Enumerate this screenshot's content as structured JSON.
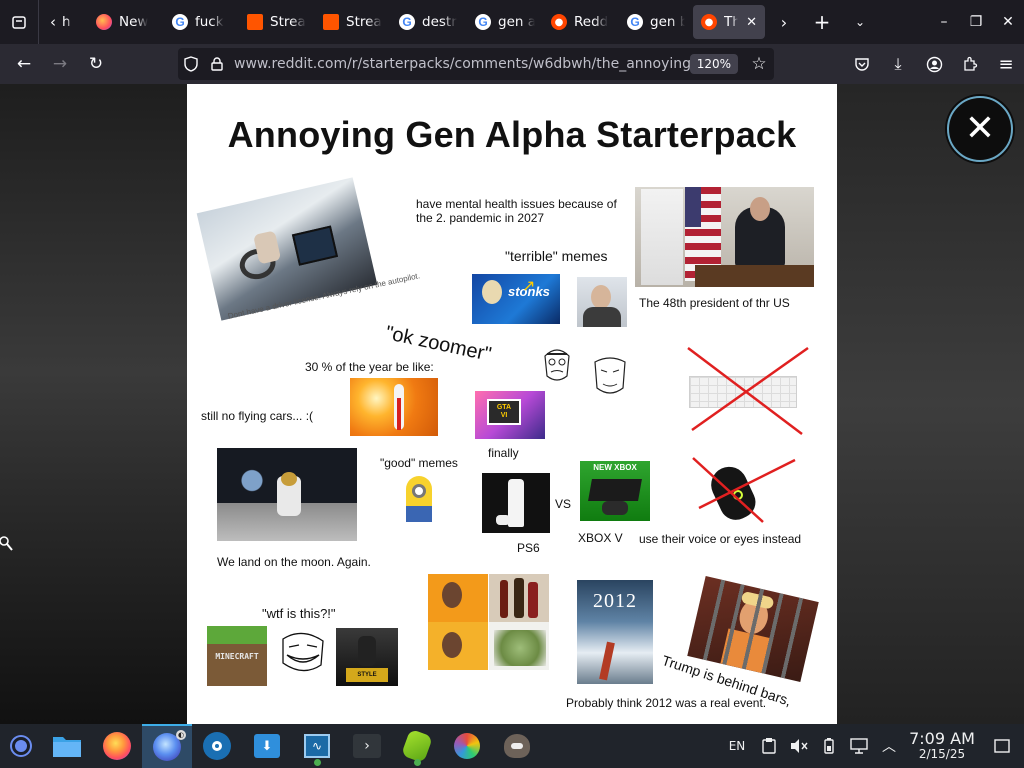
{
  "browser": {
    "tabs": [
      {
        "label": "h",
        "favicon": "back-arrow-icon",
        "color": "#fbfbfe"
      },
      {
        "label": "New",
        "favicon": "firefox-icon",
        "color": "#ff7139"
      },
      {
        "label": "fuck",
        "favicon": "google-icon",
        "color": "#4285f4"
      },
      {
        "label": "Strea",
        "favicon": "soundcloud-icon",
        "color": "#ff5500"
      },
      {
        "label": "Strea",
        "favicon": "soundcloud-icon",
        "color": "#ff5500"
      },
      {
        "label": "destr",
        "favicon": "google-icon",
        "color": "#4285f4"
      },
      {
        "label": "gen a",
        "favicon": "google-icon",
        "color": "#4285f4"
      },
      {
        "label": "Redd",
        "favicon": "reddit-icon",
        "color": "#ff4500"
      },
      {
        "label": "gen b",
        "favicon": "google-icon",
        "color": "#4285f4"
      },
      {
        "label": "Th",
        "favicon": "reddit-icon",
        "color": "#ff4500",
        "active": true
      }
    ],
    "url": "www.reddit.com/r/starterpacks/comments/w6dbwh/the_annoying_g",
    "zoom": "120%"
  },
  "meme": {
    "title": "Annoying Gen Alpha Starterpack",
    "captions": {
      "mental_health": "have mental health issues because of the 2. pandemic in 2027",
      "terrible_memes": "\"terrible\" memes",
      "stonks": "stonks",
      "president": "The 48th president of thr US",
      "driver": "Dont have a driver license. Always rely on the autopilot.",
      "ok_zoomer": "\"ok zoomer\"",
      "heat": "30 % of the year be like:",
      "flying_cars": "still no flying cars... :(",
      "finally": "finally",
      "good_memes": "\"good\" memes",
      "vs": "VS",
      "ps6": "PS6",
      "xbox": "XBOX V",
      "new_xbox": "NEW XBOX",
      "voice": "use their voice or eyes instead",
      "moon": "We land on the moon. Again.",
      "wtf": "\"wtf is this?!\"",
      "minecraft": "MINECRAFT",
      "year_2012": "2012",
      "trump": "Trump is behind bars,",
      "real_event": "Probably think 2012 was a real event."
    }
  },
  "taskbar": {
    "lang": "EN",
    "time": "7:09 AM",
    "date": "2/15/25"
  }
}
